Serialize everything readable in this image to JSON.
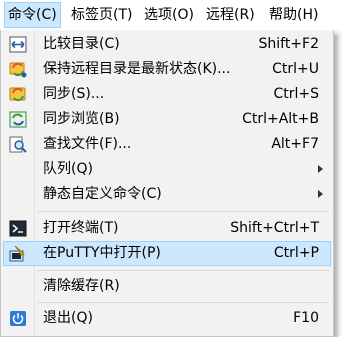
{
  "menubar": {
    "items": [
      {
        "label": "命令(C)",
        "active": true
      },
      {
        "label": "标签页(T)"
      },
      {
        "label": "选项(O)"
      },
      {
        "label": "远程(R)"
      },
      {
        "label": "帮助(H)"
      }
    ]
  },
  "menu": {
    "items": [
      {
        "label": "比较目录(C)",
        "shortcut": "Shift+F2",
        "icon": "compare-dirs-icon"
      },
      {
        "label": "保持远程目录是最新状态(K)...",
        "shortcut": "Ctrl+U",
        "icon": "keep-up-to-date-icon"
      },
      {
        "label": "同步(S)...",
        "shortcut": "Ctrl+S",
        "icon": "synchronize-icon"
      },
      {
        "label": "同步浏览(B)",
        "shortcut": "Ctrl+Alt+B",
        "icon": "sync-browse-icon"
      },
      {
        "label": "查找文件(F)...",
        "shortcut": "Alt+F7",
        "icon": "find-files-icon"
      },
      {
        "label": "队列(Q)",
        "shortcut": ""
      },
      {
        "label": "静态自定义命令(C)",
        "shortcut": ""
      },
      {
        "label": "打开终端(T)",
        "shortcut": "Shift+Ctrl+T",
        "icon": "terminal-icon"
      },
      {
        "label": "在PuTTY中打开(P)",
        "shortcut": "Ctrl+P",
        "icon": "putty-icon"
      },
      {
        "label": "清除缓存(R)",
        "shortcut": ""
      },
      {
        "label": "退出(Q)",
        "shortcut": "F10",
        "icon": "power-icon"
      }
    ]
  },
  "colors": {
    "highlight_bg": "#cce8ff",
    "highlight_border": "#99d1ff",
    "menu_bg": "#f2f2f2"
  }
}
